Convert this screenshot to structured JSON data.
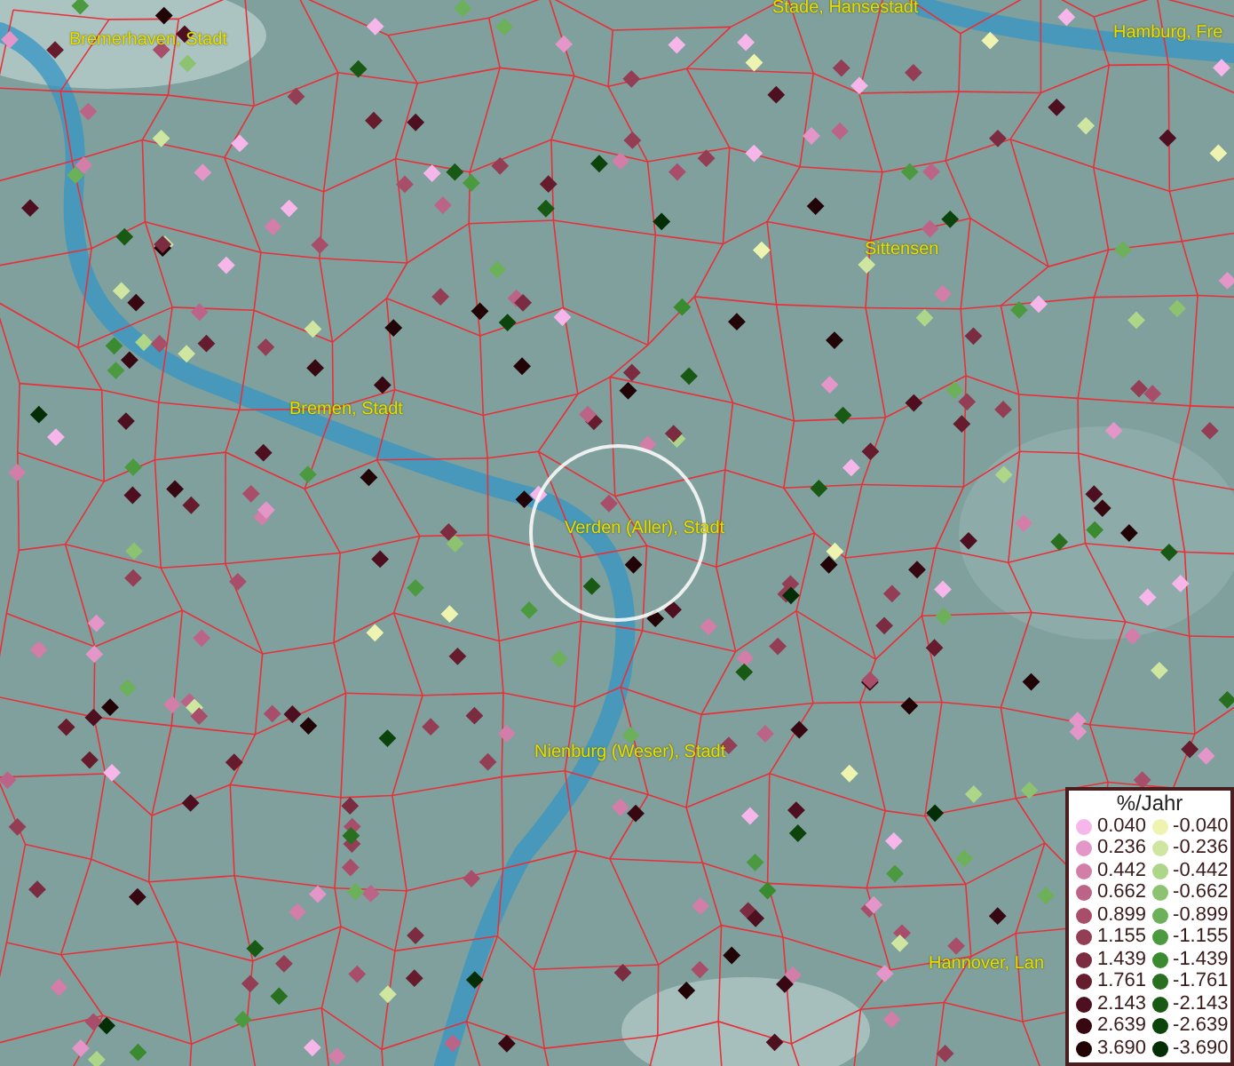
{
  "map": {
    "labels": [
      "Bremerhaven, Stadt",
      "Stade, Hansestadt",
      "Hamburg, Fre",
      "Sittensen",
      "Bremen, Stadt",
      "Verden (Aller), Stadt",
      "Nienburg (Weser), Stadt",
      "Hannover, Lan"
    ]
  },
  "legend": {
    "title": "%/Jahr",
    "positive": [
      {
        "value": "0.040",
        "color": "#f6b6ea"
      },
      {
        "value": "0.236",
        "color": "#e496c8"
      },
      {
        "value": "0.442",
        "color": "#d27ea8"
      },
      {
        "value": "0.662",
        "color": "#bc6488"
      },
      {
        "value": "0.899",
        "color": "#a84e6a"
      },
      {
        "value": "1.155",
        "color": "#933e54"
      },
      {
        "value": "1.439",
        "color": "#7c2c40"
      },
      {
        "value": "1.761",
        "color": "#661c2c"
      },
      {
        "value": "2.143",
        "color": "#4e1020"
      },
      {
        "value": "2.639",
        "color": "#380812"
      },
      {
        "value": "3.690",
        "color": "#220306"
      }
    ],
    "negative": [
      {
        "value": "-0.040",
        "color": "#eef4b0"
      },
      {
        "value": "-0.236",
        "color": "#cfe6a0"
      },
      {
        "value": "-0.442",
        "color": "#aed688"
      },
      {
        "value": "-0.662",
        "color": "#8cc270"
      },
      {
        "value": "-0.899",
        "color": "#6cb05a"
      },
      {
        "value": "-1.155",
        "color": "#4c9a40"
      },
      {
        "value": "-1.439",
        "color": "#3a8a30"
      },
      {
        "value": "-1.761",
        "color": "#287020"
      },
      {
        "value": "-2.143",
        "color": "#185a14"
      },
      {
        "value": "-2.639",
        "color": "#0c440c"
      },
      {
        "value": "-3.690",
        "color": "#042e05"
      }
    ]
  }
}
